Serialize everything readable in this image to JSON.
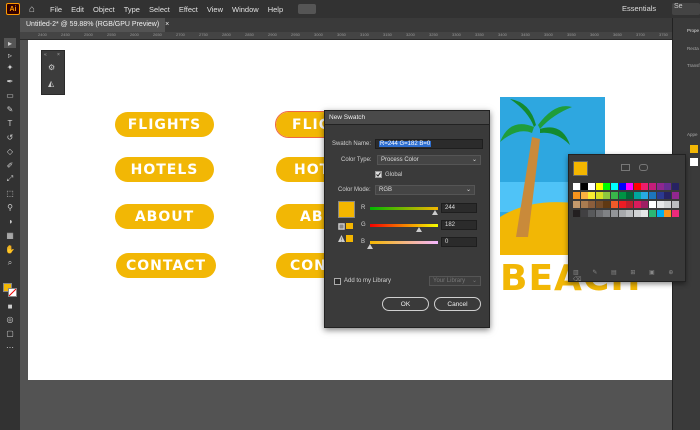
{
  "app": {
    "logo": "Ai",
    "workspace": "Essentials",
    "search_placeholder": "Se"
  },
  "menu": [
    "File",
    "Edit",
    "Object",
    "Type",
    "Select",
    "Effect",
    "View",
    "Window",
    "Help"
  ],
  "document_tab": "Untitled-2* @ 59.88% (RGB/GPU Preview)",
  "ruler_ticks": [
    "2400",
    "2450",
    "2500",
    "2550",
    "2600",
    "2650",
    "2700",
    "2750",
    "2800",
    "2850",
    "2900",
    "2950",
    "3000",
    "3050",
    "3100",
    "3150",
    "3200",
    "3250",
    "3300",
    "3350",
    "3400",
    "3450",
    "3500",
    "3550",
    "3600",
    "3650",
    "3700",
    "3750"
  ],
  "artwork": {
    "buttons_left": [
      "FLIGHTS",
      "HOTELS",
      "ABOUT",
      "CONTACT"
    ],
    "buttons_mid": [
      "FLIG",
      "HOT",
      "ABO",
      "CON"
    ],
    "beach_text": "BEACH",
    "brand_yellow": "#f2b705"
  },
  "dialog": {
    "title": "New Swatch",
    "swatch_name_label": "Swatch Name:",
    "swatch_name_value": "R=244 G=182 B=0",
    "color_type_label": "Color Type:",
    "color_type_value": "Process Color",
    "global_label": "Global",
    "global_checked": true,
    "color_mode_label": "Color Mode:",
    "color_mode_value": "RGB",
    "channels": [
      {
        "label": "R",
        "value": "244",
        "fraction": 0.957
      },
      {
        "label": "G",
        "value": "182",
        "fraction": 0.714
      },
      {
        "label": "B",
        "value": "0",
        "fraction": 0.0
      }
    ],
    "add_to_library_label": "Add to my Library",
    "library_value": "Your Library",
    "ok_label": "OK",
    "cancel_label": "Cancel",
    "preview_color": "#f4b600"
  },
  "right_panel": {
    "labels": [
      "Prope",
      "Recta",
      "Transf",
      "Appe",
      "Stroke"
    ]
  }
}
